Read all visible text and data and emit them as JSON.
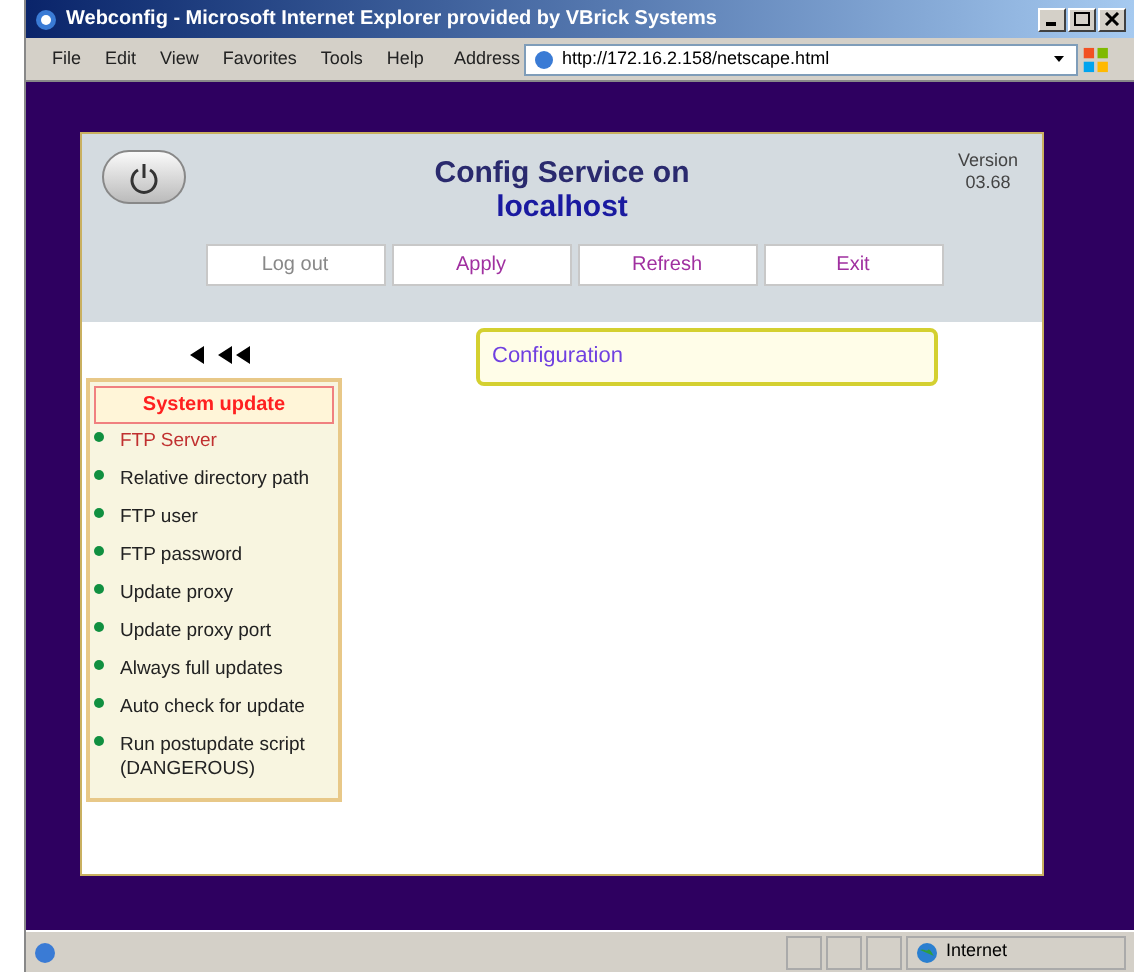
{
  "window": {
    "title": "Webconfig - Microsoft Internet Explorer provided by VBrick Systems"
  },
  "menu": [
    "File",
    "Edit",
    "View",
    "Favorites",
    "Tools",
    "Help"
  ],
  "address": {
    "label": "Address",
    "value": "http://172.16.2.158/netscape.html"
  },
  "header": {
    "title": "Config Service on",
    "host": "localhost",
    "version_label": "Version",
    "version": "03.68"
  },
  "buttons": [
    {
      "label": "Log out",
      "disabled": true
    },
    {
      "label": "Apply",
      "disabled": false
    },
    {
      "label": "Refresh",
      "disabled": false
    },
    {
      "label": "Exit",
      "disabled": false
    }
  ],
  "sidebar": {
    "title": "System update",
    "items": [
      {
        "label": "FTP Server",
        "selected": true
      },
      {
        "label": "Relative directory path",
        "selected": false
      },
      {
        "label": "FTP user",
        "selected": false
      },
      {
        "label": "FTP password",
        "selected": false
      },
      {
        "label": "Update proxy",
        "selected": false
      },
      {
        "label": "Update proxy port",
        "selected": false
      },
      {
        "label": "Always full updates",
        "selected": false
      },
      {
        "label": "Auto check for update",
        "selected": false
      },
      {
        "label": "Run postupdate script (DANGEROUS)",
        "selected": false
      }
    ]
  },
  "content": {
    "title": "Configuration"
  },
  "status_bar": {
    "zone": "Internet"
  }
}
